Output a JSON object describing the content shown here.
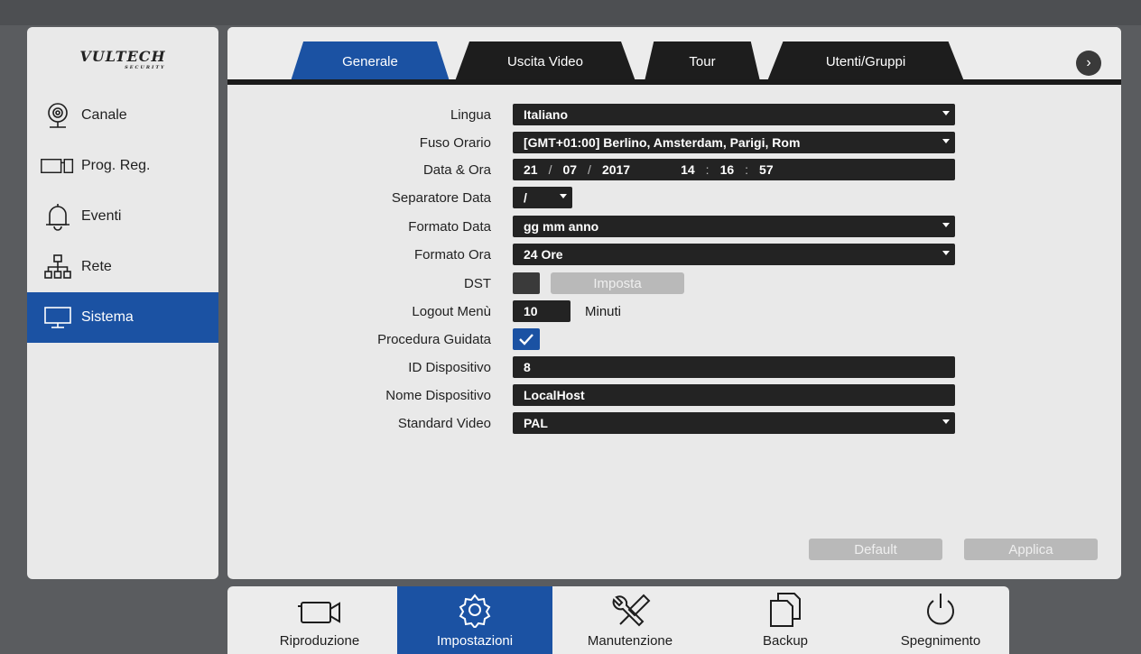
{
  "brand": {
    "name": "VULTECH",
    "sub": "SECURITY"
  },
  "sidebar": {
    "items": [
      {
        "label": "Canale",
        "icon": "camera-icon"
      },
      {
        "label": "Prog. Reg.",
        "icon": "record-schedule-icon"
      },
      {
        "label": "Eventi",
        "icon": "bell-icon"
      },
      {
        "label": "Rete",
        "icon": "network-icon"
      },
      {
        "label": "Sistema",
        "icon": "monitor-icon",
        "active": true
      }
    ]
  },
  "tabs": [
    {
      "label": "Generale",
      "active": true
    },
    {
      "label": "Uscita Video"
    },
    {
      "label": "Tour"
    },
    {
      "label": "Utenti/Gruppi"
    }
  ],
  "form": {
    "lingua": {
      "label": "Lingua",
      "value": "Italiano"
    },
    "fuso": {
      "label": "Fuso Orario",
      "value": "[GMT+01:00] Berlino, Amsterdam, Parigi, Rom"
    },
    "data_ora": {
      "label": "Data & Ora",
      "day": "21",
      "month": "07",
      "year": "2017",
      "hh": "14",
      "mm": "16",
      "ss": "57"
    },
    "separatore": {
      "label": "Separatore Data",
      "value": "/"
    },
    "formato_data": {
      "label": "Formato Data",
      "value": "gg mm anno"
    },
    "formato_ora": {
      "label": "Formato Ora",
      "value": "24 Ore"
    },
    "dst": {
      "label": "DST",
      "button": "Imposta",
      "checked": false
    },
    "logout": {
      "label": "Logout Menù",
      "value": "10",
      "unit": "Minuti"
    },
    "procedura": {
      "label": "Procedura Guidata",
      "checked": true
    },
    "id_dispositivo": {
      "label": "ID Dispositivo",
      "value": "8"
    },
    "nome_dispositivo": {
      "label": "Nome Dispositivo",
      "value": "LocalHost"
    },
    "standard_video": {
      "label": "Standard Video",
      "value": "PAL"
    }
  },
  "actions": {
    "default": "Default",
    "apply": "Applica"
  },
  "dock": [
    {
      "label": "Riproduzione",
      "icon": "playback-camera-icon"
    },
    {
      "label": "Impostazioni",
      "icon": "gear-icon",
      "active": true
    },
    {
      "label": "Manutenzione",
      "icon": "tools-icon"
    },
    {
      "label": "Backup",
      "icon": "copy-icon"
    },
    {
      "label": "Spegnimento",
      "icon": "power-icon"
    }
  ],
  "colors": {
    "accent": "#1b52a3",
    "field": "#232323",
    "panel": "#e9e9e9"
  }
}
